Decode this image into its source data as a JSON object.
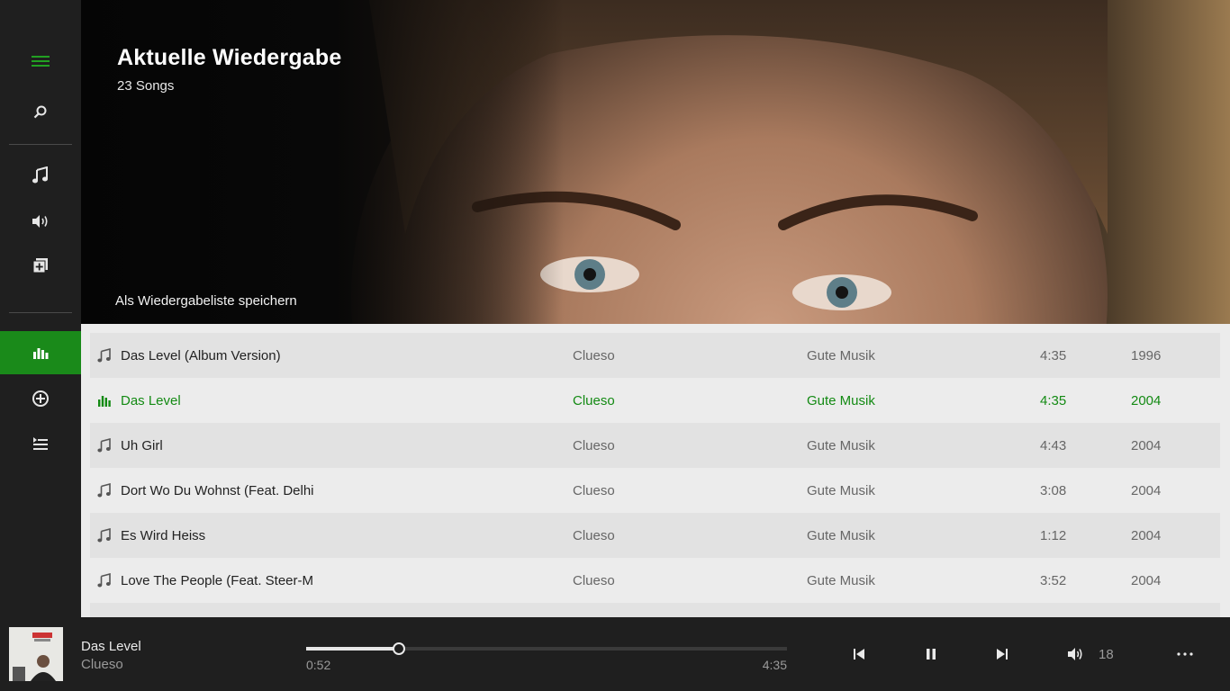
{
  "hero": {
    "title": "Aktuelle Wiedergabe",
    "subtitle": "23 Songs",
    "save_label": "Als Wiedergabeliste speichern"
  },
  "sidebar": {
    "items": [
      {
        "name": "hamburger-menu-icon"
      },
      {
        "name": "search-icon"
      },
      {
        "name": "music-note-icon"
      },
      {
        "name": "radio-broadcast-icon"
      },
      {
        "name": "add-collection-icon"
      },
      {
        "name": "now-playing-bars-icon",
        "active": true
      },
      {
        "name": "add-circle-icon"
      },
      {
        "name": "playlist-icon"
      }
    ]
  },
  "tracks": [
    {
      "title": "Das Level (Album Version)",
      "artist": "Clueso",
      "album": "Gute Musik",
      "duration": "4:35",
      "year": "1996"
    },
    {
      "title": "Das Level",
      "artist": "Clueso",
      "album": "Gute Musik",
      "duration": "4:35",
      "year": "2004",
      "playing": true
    },
    {
      "title": "Uh Girl",
      "artist": "Clueso",
      "album": "Gute Musik",
      "duration": "4:43",
      "year": "2004"
    },
    {
      "title": "Dort Wo Du Wohnst (Feat. Delhi",
      "artist": "Clueso",
      "album": "Gute Musik",
      "duration": "3:08",
      "year": "2004"
    },
    {
      "title": "Es Wird Heiss",
      "artist": "Clueso",
      "album": "Gute Musik",
      "duration": "1:12",
      "year": "2004"
    },
    {
      "title": "Love The People (Feat. Steer-M",
      "artist": "Clueso",
      "album": "Gute Musik",
      "duration": "3:52",
      "year": "2004"
    }
  ],
  "player": {
    "title": "Das Level",
    "artist": "Clueso",
    "current_time": "0:52",
    "total_time": "4:35",
    "progress": 0.193,
    "volume": "18"
  },
  "colors": {
    "accent": "#138a13",
    "sidebar_bg": "#1f1f1f",
    "list_bg": "#ececec"
  }
}
